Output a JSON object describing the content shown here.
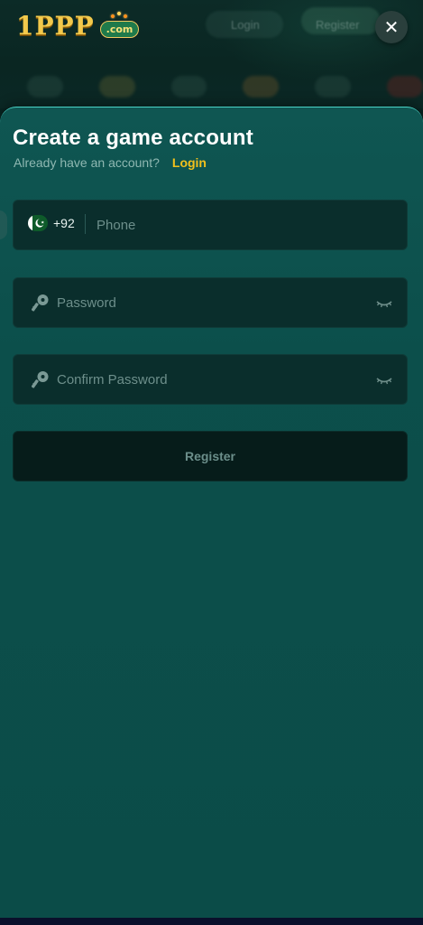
{
  "header": {
    "logo_text": "1PPP",
    "logo_badge": ".com",
    "login_label": "Login",
    "register_label": "Register"
  },
  "modal": {
    "title": "Create a game account",
    "subtext": "Already have an account?",
    "login_link": "Login",
    "phone": {
      "country_code": "+92",
      "placeholder": "Phone"
    },
    "password": {
      "placeholder": "Password"
    },
    "confirm_password": {
      "placeholder": "Confirm Password"
    },
    "register_button": "Register"
  },
  "icons": {
    "close": "close-icon",
    "flag": "pakistan-flag-icon",
    "key": "key-icon",
    "eye": "eye-closed-icon"
  },
  "colors": {
    "panel_bg": "#0c4f4b",
    "accent": "#f2c11c",
    "input_bg": "#0a2e2c",
    "button_bg": "#061c1a"
  }
}
